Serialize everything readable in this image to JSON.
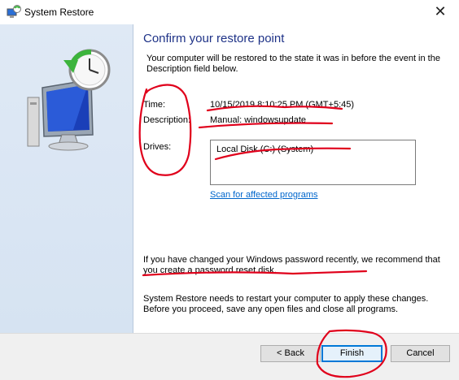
{
  "window": {
    "title": "System Restore",
    "close_glyph": "✕"
  },
  "main": {
    "heading": "Confirm your restore point",
    "intro": "Your computer will be restored to the state it was in before the event in the Description field below.",
    "time_label": "Time:",
    "time_value": "10/15/2019 8:10:25 PM (GMT+5:45)",
    "description_label": "Description:",
    "description_value": "Manual: windowsupdate",
    "drives_label": "Drives:",
    "drives": [
      "Local Disk (C:) (System)"
    ],
    "scan_link": "Scan for affected programs",
    "password_note": "If you have changed your Windows password recently, we recommend that you create a password reset disk.",
    "restart_note": "System Restore needs to restart your computer to apply these changes. Before you proceed, save any open files and close all programs."
  },
  "buttons": {
    "back": "< Back",
    "finish": "Finish",
    "cancel": "Cancel"
  },
  "icons": {
    "app": "system-restore-icon",
    "hero": "monitor-clock-restore-icon",
    "close": "close-icon"
  },
  "colors": {
    "heading": "#1e3287",
    "link": "#0066cc",
    "sidebar": "#dfe9f5",
    "annotation": "#e0001b"
  }
}
